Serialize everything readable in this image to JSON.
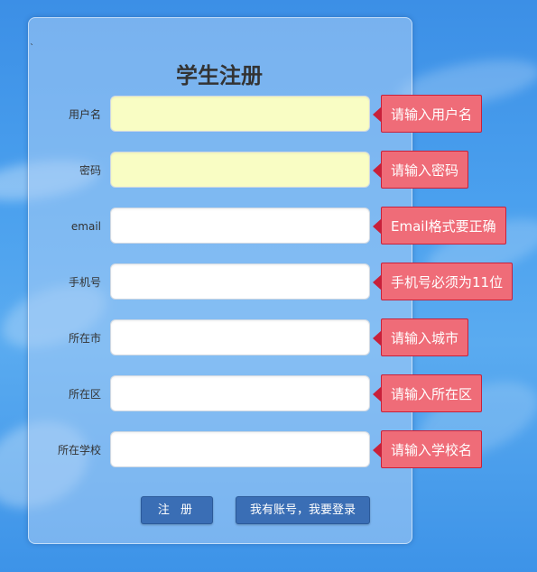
{
  "form": {
    "title": "学生注册",
    "tick": "`",
    "fields": [
      {
        "label": "用户名",
        "value": "",
        "tip": "请输入用户名",
        "highlighted": true
      },
      {
        "label": "密码",
        "value": "",
        "tip": "请输入密码",
        "highlighted": true
      },
      {
        "label": "email",
        "value": "",
        "tip": "Email格式要正确",
        "highlighted": false
      },
      {
        "label": "手机号",
        "value": "",
        "tip": "手机号必须为11位",
        "highlighted": false
      },
      {
        "label": "所在市",
        "value": "",
        "tip": "请输入城市",
        "highlighted": false
      },
      {
        "label": "所在区",
        "value": "",
        "tip": "请输入所在区",
        "highlighted": false
      },
      {
        "label": "所在学校",
        "value": "",
        "tip": "请输入学校名",
        "highlighted": false
      }
    ],
    "register_label": "注 册",
    "login_label": "我有账号，我要登录"
  },
  "colors": {
    "tip_bg": "#ef6c78",
    "tip_border": "#c8203a",
    "highlight_field": "#f9fdc4",
    "button_bg": "#3a6eb5"
  }
}
